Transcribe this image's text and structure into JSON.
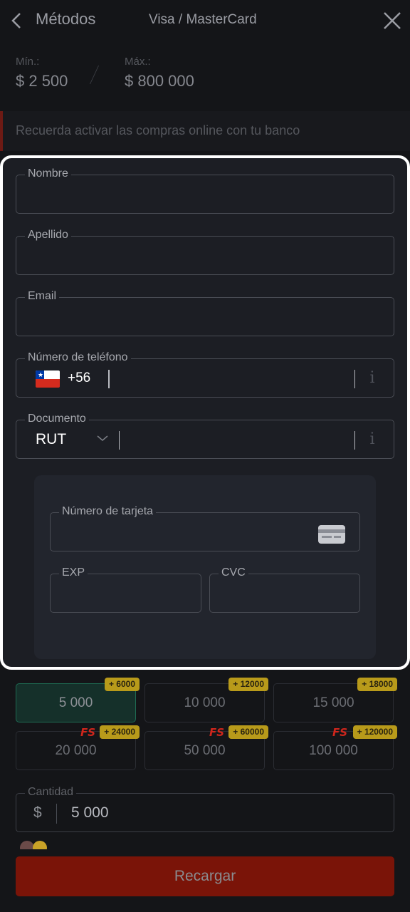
{
  "header": {
    "title": "Métodos",
    "subtitle": "Visa / MasterCard"
  },
  "limits": {
    "min_label": "Mín.:",
    "min_value": "$ 2 500",
    "max_label": "Máx.:",
    "max_value": "$ 800 000"
  },
  "notice": {
    "text": "Recuerda activar las compras online con tu banco"
  },
  "form": {
    "nombre_label": "Nombre",
    "apellido_label": "Apellido",
    "email_label": "Email",
    "phone_label": "Número de teléfono",
    "phone_code": "+56",
    "document_label": "Documento",
    "document_type": "RUT",
    "info_glyph": "i",
    "card": {
      "number_label": "Número de tarjeta",
      "exp_label": "EXP",
      "cvc_label": "CVC"
    }
  },
  "amounts": [
    {
      "value": "5 000",
      "bonus": "+ 6000",
      "fs": "",
      "selected": true
    },
    {
      "value": "10 000",
      "bonus": "+ 12000",
      "fs": "",
      "selected": false
    },
    {
      "value": "15 000",
      "bonus": "+ 18000",
      "fs": "",
      "selected": false
    },
    {
      "value": "20 000",
      "bonus": "+ 24000",
      "fs": "FS",
      "selected": false
    },
    {
      "value": "50 000",
      "bonus": "+ 60000",
      "fs": "FS",
      "selected": false
    },
    {
      "value": "100 000",
      "bonus": "+ 120000",
      "fs": "FS",
      "selected": false
    }
  ],
  "quantity": {
    "label": "Cantidad",
    "currency": "$",
    "value": "5 000"
  },
  "recharge_label": "Recargar",
  "colors": {
    "background": "#141518",
    "accent_red": "#7a1408",
    "selected_green": "#15302a",
    "bonus_gold": "#b89a1a"
  }
}
